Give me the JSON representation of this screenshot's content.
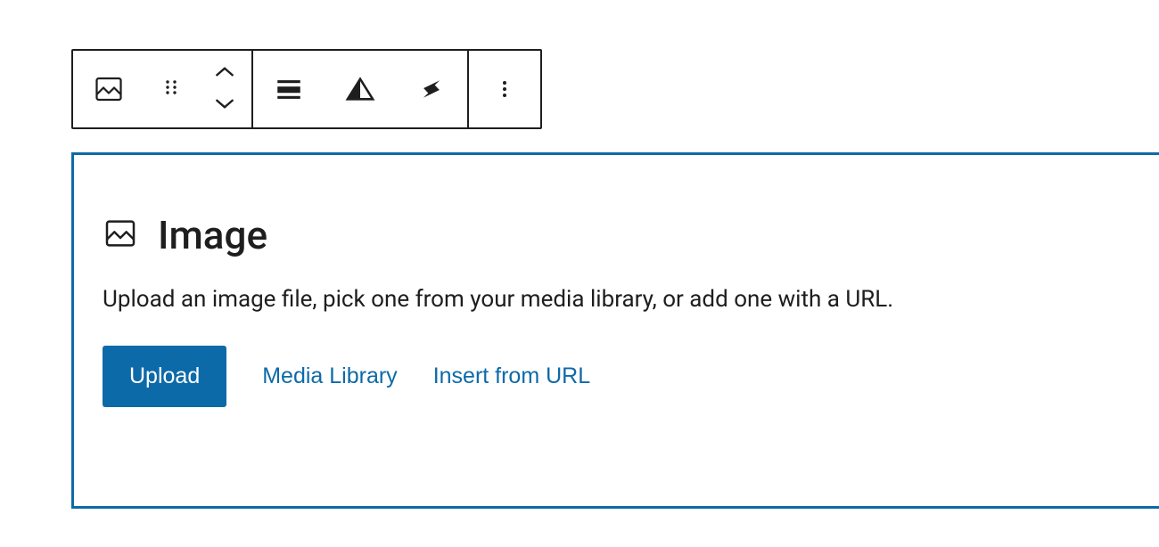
{
  "block": {
    "title": "Image",
    "description": "Upload an image file, pick one from your media library, or add one with a URL.",
    "actions": {
      "upload": "Upload",
      "media_library": "Media Library",
      "insert_url": "Insert from URL"
    }
  },
  "toolbar": {
    "icons": {
      "block_type": "image-icon",
      "drag": "drag-handle-icon",
      "move_up": "chevron-up-icon",
      "move_down": "chevron-down-icon",
      "align": "align-icon",
      "duotone": "duotone-icon",
      "crop": "crop-icon",
      "more": "more-options-icon"
    }
  },
  "colors": {
    "accent": "#0d6aa8",
    "primary_btn_bg": "#0d6aa8",
    "text": "#1e1e1e"
  }
}
